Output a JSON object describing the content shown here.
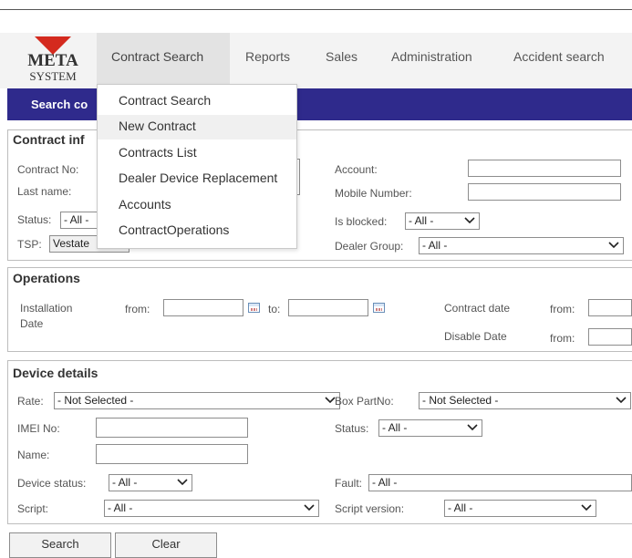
{
  "brand": {
    "logo_line1": "META",
    "logo_line2": "SYSTEM",
    "colors": {
      "red": "#d42a1e",
      "navy": "#2f2a8c"
    }
  },
  "nav": {
    "items": [
      "Contract Search",
      "Reports",
      "Sales",
      "Administration",
      "Accident search"
    ],
    "active": "Contract Search"
  },
  "bluebar": {
    "label": "Search co"
  },
  "dropdown": {
    "items": [
      "Contract Search",
      "New Contract",
      "Contracts List",
      "Dealer Device Replacement",
      "Accounts",
      "ContractOperations"
    ],
    "highlighted": "New Contract"
  },
  "contract_info": {
    "title": "Contract inf",
    "contract_no_label": "Contract No:",
    "last_name_label": "Last name:",
    "status_label": "Status:",
    "status_value": "- All -",
    "tsp_label": "TSP:",
    "tsp_value": "Vestate",
    "account_label": "Account:",
    "mobile_label": "Mobile Number:",
    "blocked_label": "Is blocked:",
    "blocked_value": "- All -",
    "dealer_group_label": "Dealer Group:",
    "dealer_group_value": "- All -"
  },
  "operations": {
    "title": "Operations",
    "installation_label_1": "Installation",
    "installation_label_2": "Date",
    "from_label": "from:",
    "to_label": "to:",
    "contract_date_label": "Contract date",
    "contract_from_label": "from:",
    "disable_date_label": "Disable Date",
    "disable_from_label": "from:"
  },
  "device": {
    "title": "Device details",
    "rate_label": "Rate:",
    "rate_value": "- Not Selected -",
    "box_label": "Box PartNo:",
    "box_value": "- Not Selected -",
    "imei_label": "IMEI No:",
    "status_label": "Status:",
    "status_value": "- All -",
    "name_label": "Name:",
    "device_status_label": "Device status:",
    "device_status_value": "- All -",
    "fault_label": "Fault:",
    "fault_value": "- All -",
    "script_label": "Script:",
    "script_value": "- All -",
    "script_version_label": "Script version:",
    "script_version_value": "- All -"
  },
  "buttons": {
    "search": "Search",
    "clear": "Clear"
  }
}
